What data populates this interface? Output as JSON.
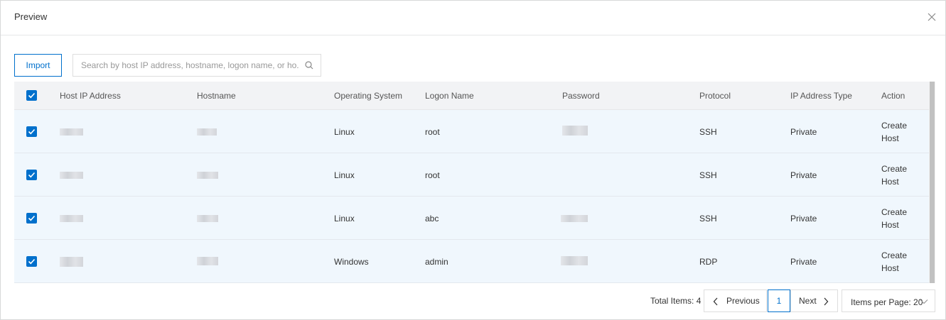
{
  "dialog": {
    "title": "Preview",
    "close_icon": "close-icon"
  },
  "toolbar": {
    "import_label": "Import",
    "search_placeholder": "Search by host IP address, hostname, logon name, or ho...",
    "search_icon": "search-icon"
  },
  "table": {
    "columns": [
      "Host IP Address",
      "Hostname",
      "Operating System",
      "Logon Name",
      "Password",
      "Protocol",
      "IP Address Type",
      "Action"
    ],
    "rows": [
      {
        "os": "Linux",
        "logon": "root",
        "protocol": "SSH",
        "ip_type": "Private",
        "action_line1": "Create",
        "action_line2": "Host"
      },
      {
        "os": "Linux",
        "logon": "root",
        "protocol": "SSH",
        "ip_type": "Private",
        "action_line1": "Create",
        "action_line2": "Host"
      },
      {
        "os": "Linux",
        "logon": "abc",
        "protocol": "SSH",
        "ip_type": "Private",
        "action_line1": "Create",
        "action_line2": "Host"
      },
      {
        "os": "Windows",
        "logon": "admin",
        "protocol": "RDP",
        "ip_type": "Private",
        "action_line1": "Create",
        "action_line2": "Host"
      }
    ]
  },
  "pagination": {
    "total": "Total Items: 4",
    "previous": "Previous",
    "current_page": "1",
    "next": "Next",
    "per_page": "Items per Page: 20"
  },
  "colors": {
    "accent": "#0070cc",
    "row_bg": "#f0f7fd",
    "header_bg": "#f2f3f5"
  }
}
